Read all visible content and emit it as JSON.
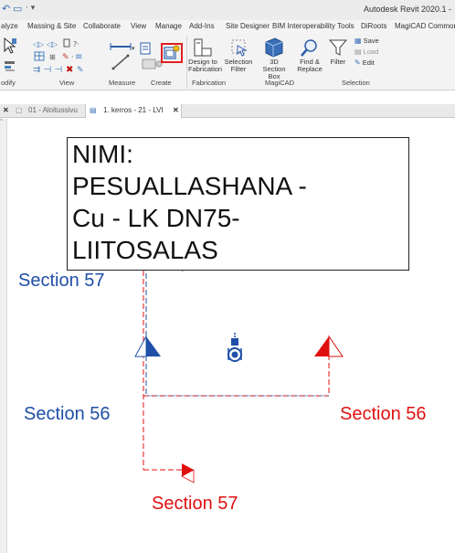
{
  "title_bar": {
    "app_title": "Autodesk Revit 2020.1 -"
  },
  "ribbon_tabs": [
    "alyze",
    "Massing & Site",
    "Collaborate",
    "View",
    "Manage",
    "Add-Ins",
    "Site Designer",
    "BIM Interoperability Tools",
    "DiRoots",
    "MagiCAD Common"
  ],
  "ribbon": {
    "buttons": {
      "design_to_fabrication": "Design to\nFabrication",
      "selection_filter": "Selection\nFilter",
      "section_box": "3D\nSection Box",
      "find_replace": "Find &\nReplace",
      "filter": "Filter",
      "save": "Save",
      "load": "Load",
      "edit": "Edit"
    },
    "groups": [
      "odify",
      "View",
      "Measure",
      "Create",
      "Fabrication",
      "MagiCAD",
      "Selection"
    ],
    "highlight_color": "#e02020"
  },
  "view_tabs": [
    {
      "label": "01 - Aloitussivu",
      "active": false
    },
    {
      "label": "1. kerros - 21 - LVI",
      "active": true
    }
  ],
  "canvas": {
    "tag_text": "NIMI:\nPESUALLASHANA -\nCu - LK DN75-\nLIITOSALAS",
    "sections": {
      "s57_top": "Section 57",
      "s56_left": "Section 56",
      "s56_right": "Section 56",
      "s57_bottom": "Section 57"
    },
    "colors": {
      "blue": "#1f4fa8",
      "red": "#e01010"
    }
  }
}
